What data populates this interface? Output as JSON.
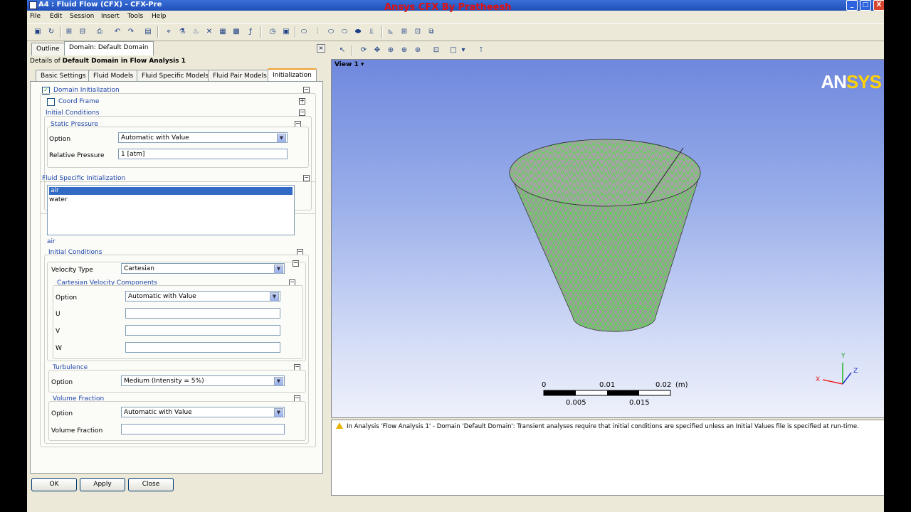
{
  "window": {
    "title": "A4 : Fluid Flow (CFX) - CFX-Pre",
    "watermark": "Ansys CFX  By Pratheesh",
    "buttons": [
      "_",
      "□",
      "X"
    ]
  },
  "menu": [
    "File",
    "Edit",
    "Session",
    "Insert",
    "Tools",
    "Help"
  ],
  "toolbar": {
    "icons": [
      "save-icon",
      "reload-icon",
      "open-icon",
      "import-icon",
      "print-icon",
      "undo-icon",
      "redo-icon",
      "material-icon",
      "mesh-icon",
      "physics-icon",
      "flask-icon",
      "expression-icon",
      "function-icon",
      "fx-icon",
      "clock-icon",
      "solver-icon",
      "domain-icon",
      "boundary-icon",
      "interface-icon",
      "subdomain-icon",
      "point-icon",
      "monitor-icon",
      "output-icon",
      "control-icon",
      "region-icon",
      "copy-icon"
    ]
  },
  "left": {
    "tabs": [
      "Outline",
      "Domain: Default Domain"
    ],
    "close_symbol": "×",
    "details_prefix": "Details of ",
    "details_bold": "Default Domain in Flow Analysis 1",
    "subtabs": [
      "Basic Settings",
      "Fluid Models",
      "Fluid Specific Models",
      "Fluid Pair Models",
      "Initialization"
    ],
    "domain_init": "Domain Initialization",
    "coord_frame": "Coord Frame",
    "initial_conditions": "Initial Conditions",
    "static_pressure": "Static Pressure",
    "option_label": "Option",
    "option_value": "Automatic with Value",
    "rel_pressure_label": "Relative Pressure",
    "rel_pressure_value": "1 [atm]",
    "fluid_specific_init": "Fluid Specific Initialization",
    "fluids": [
      "air",
      "water"
    ],
    "selected_fluid": "air",
    "initial_conditions2": "Initial Conditions",
    "velocity_type_label": "Velocity Type",
    "velocity_type_value": "Cartesian",
    "cart_vel": "Cartesian Velocity Components",
    "cv_option_label": "Option",
    "cv_option_value": "Automatic with Value",
    "u_label": "U",
    "v_label": "V",
    "w_label": "W",
    "turbulence": "Turbulence",
    "turb_option_label": "Option",
    "turb_option_value": "Medium (Intensity = 5%)",
    "volume_fraction": "Volume Fraction",
    "vf_option_label": "Option",
    "vf_option_value": "Automatic with Value",
    "vf_label": "Volume Fraction",
    "buttons": {
      "ok": "OK",
      "apply": "Apply",
      "close": "Close"
    }
  },
  "viewer": {
    "view_label": "View 1",
    "logo_an": "AN",
    "logo_sys": "SYS",
    "scale_top": [
      "0",
      "0.01",
      "0.02",
      "(m)"
    ],
    "scale_bottom": [
      "0.005",
      "0.015"
    ],
    "axes": [
      "Y",
      "Z",
      "X"
    ]
  },
  "message": "In Analysis 'Flow Analysis 1' - Domain 'Default Domain': Transient analyses require that initial conditions are specified unless an Initial Values file is specified at run-time."
}
